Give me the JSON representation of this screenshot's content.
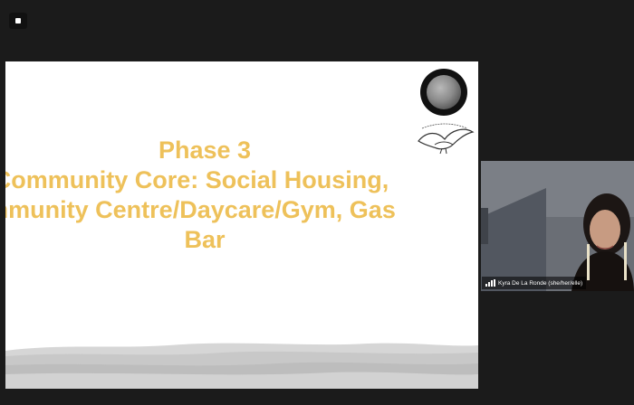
{
  "slide": {
    "title_lines": [
      "Phase 3",
      "Community Core: Social Housing,",
      "mmunity Centre/Daycare/Gym, Gas",
      "Bar"
    ],
    "accent_color": "#eec15a"
  },
  "participant": {
    "name": "Kyra De La Ronde (she/her/elle)",
    "signal_icon": "signal-bars-icon"
  },
  "toolbar": {
    "view_icon": "view-options-icon"
  }
}
